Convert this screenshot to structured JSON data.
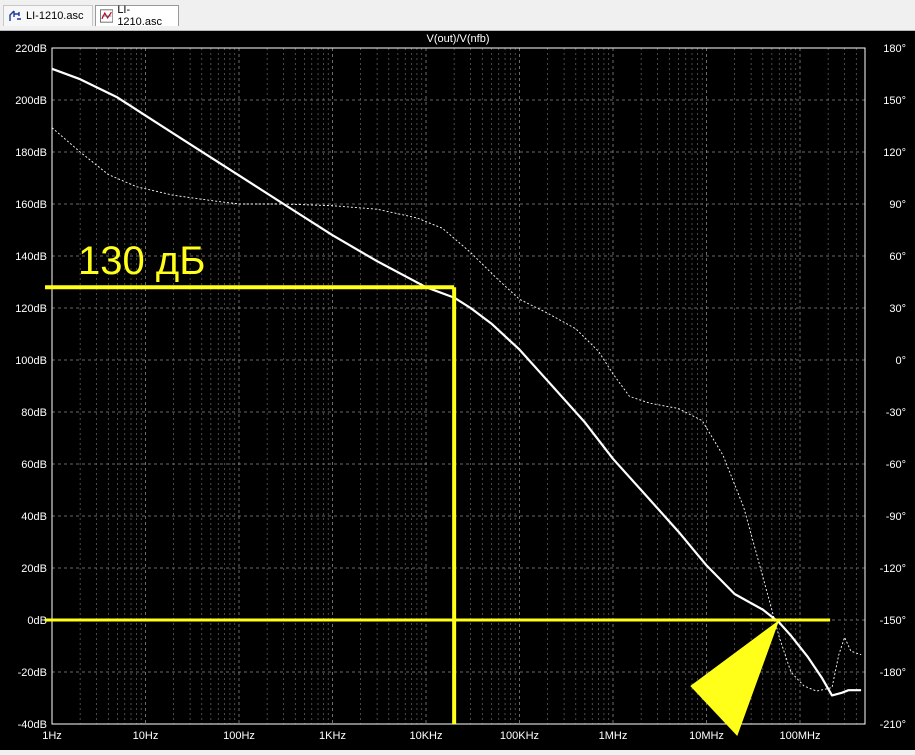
{
  "tabs": [
    {
      "label": "LI-1210.asc",
      "icon": "schematic-icon"
    },
    {
      "label": "LI-1210.asc",
      "icon": "waveform-icon"
    }
  ],
  "chart_data": {
    "type": "line",
    "title": "V(out)/V(nfb)",
    "xscale": "log",
    "x_ticks": [
      "1Hz",
      "10Hz",
      "100Hz",
      "1KHz",
      "10KHz",
      "100KHz",
      "1MHz",
      "10MHz",
      "100MHz"
    ],
    "y_ticks_left": [
      "220dB",
      "200dB",
      "180dB",
      "160dB",
      "140dB",
      "120dB",
      "100dB",
      "80dB",
      "60dB",
      "40dB",
      "20dB",
      "0dB",
      "-20dB",
      "-40dB"
    ],
    "y_ticks_right": [
      "180°",
      "150°",
      "120°",
      "90°",
      "60°",
      "30°",
      "0°",
      "-30°",
      "-60°",
      "-90°",
      "-120°",
      "-150°",
      "-180°",
      "-210°"
    ],
    "ylim_left_db": [
      -40,
      220
    ],
    "ylim_right_deg": [
      -210,
      180
    ],
    "grid": true,
    "series": [
      {
        "role": "magnitude",
        "color": "#ffffff",
        "points": [
          [
            1,
            212
          ],
          [
            2,
            208
          ],
          [
            5,
            201
          ],
          [
            10,
            194
          ],
          [
            30,
            183
          ],
          [
            100,
            171
          ],
          [
            300,
            160
          ],
          [
            1000,
            148
          ],
          [
            3000,
            138
          ],
          [
            10000,
            128
          ],
          [
            20000,
            124
          ],
          [
            30000,
            120
          ],
          [
            50000,
            114
          ],
          [
            100000,
            104
          ],
          [
            200000,
            92
          ],
          [
            500000,
            76
          ],
          [
            1000000,
            62
          ],
          [
            2000000,
            50
          ],
          [
            5000000,
            34
          ],
          [
            10000000,
            21
          ],
          [
            20000000,
            10
          ],
          [
            40000000,
            4
          ],
          [
            60000000,
            -1
          ],
          [
            80000000,
            -6
          ],
          [
            120000000,
            -14
          ],
          [
            170000000,
            -22
          ],
          [
            220000000,
            -29
          ],
          [
            280000000,
            -28
          ],
          [
            330000000,
            -27
          ],
          [
            450000000,
            -27
          ]
        ]
      },
      {
        "role": "phase",
        "color": "#ffffff",
        "dashed": true,
        "points": [
          [
            1,
            134
          ],
          [
            2,
            120
          ],
          [
            4,
            107
          ],
          [
            8,
            100
          ],
          [
            20,
            95
          ],
          [
            50,
            92
          ],
          [
            100,
            90
          ],
          [
            300,
            90
          ],
          [
            1000,
            89
          ],
          [
            3000,
            87
          ],
          [
            8000,
            82
          ],
          [
            15000,
            76
          ],
          [
            30000,
            62
          ],
          [
            60000,
            46
          ],
          [
            100000,
            35
          ],
          [
            200000,
            27
          ],
          [
            400000,
            18
          ],
          [
            700000,
            5
          ],
          [
            1000000,
            -8
          ],
          [
            1500000,
            -21
          ],
          [
            2500000,
            -25
          ],
          [
            5000000,
            -28
          ],
          [
            9000000,
            -35
          ],
          [
            15000000,
            -55
          ],
          [
            25000000,
            -85
          ],
          [
            40000000,
            -125
          ],
          [
            60000000,
            -160
          ],
          [
            80000000,
            -180
          ],
          [
            110000000,
            -188
          ],
          [
            150000000,
            -191
          ],
          [
            220000000,
            -189
          ],
          [
            260000000,
            -170
          ],
          [
            300000000,
            -160
          ],
          [
            350000000,
            -168
          ],
          [
            450000000,
            -170
          ]
        ]
      }
    ],
    "annotations": {
      "label": "130 дБ",
      "color": "#ffff1a",
      "h_line_db": 128,
      "v_line_freq": 20000,
      "zero_line_db": 0,
      "zero_line_end_freq": 210000000,
      "arrow_tip_freq": 60000000,
      "arrow_tip_db": 0
    }
  }
}
